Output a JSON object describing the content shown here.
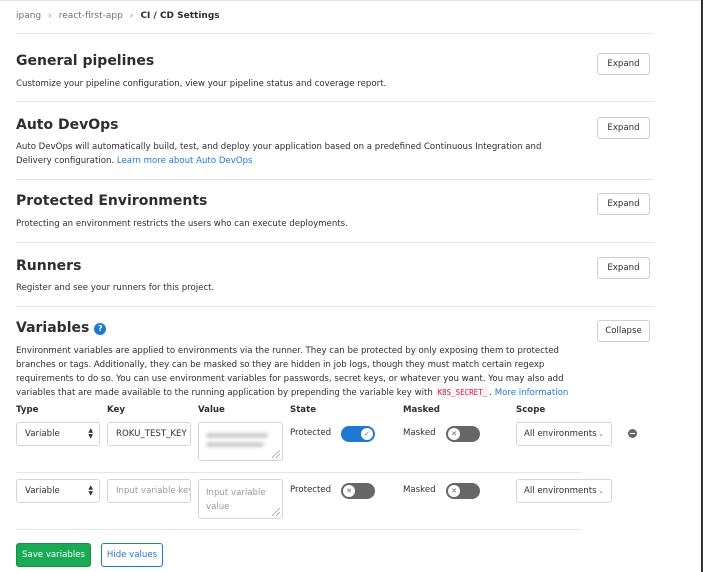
{
  "breadcrumb": {
    "items": [
      "ipang",
      "react-first-app",
      "CI / CD Settings"
    ]
  },
  "sections": {
    "general": {
      "title": "General pipelines",
      "description": "Customize your pipeline configuration, view your pipeline status and coverage report.",
      "button": "Expand"
    },
    "autodevops": {
      "title": "Auto DevOps",
      "description": "Auto DevOps will automatically build, test, and deploy your application based on a predefined Continuous Integration and Delivery configuration.",
      "link": "Learn more about Auto DevOps",
      "button": "Expand"
    },
    "protected": {
      "title": "Protected Environments",
      "description": "Protecting an environment restricts the users who can execute deployments.",
      "button": "Expand"
    },
    "runners": {
      "title": "Runners",
      "description": "Register and see your runners for this project.",
      "button": "Expand"
    },
    "variables": {
      "title": "Variables",
      "help_icon": "?",
      "button": "Collapse",
      "description": "Environment variables are applied to environments via the runner. They can be protected by only exposing them to protected branches or tags. Additionally, they can be masked so they are hidden in job logs, though they must match certain regexp requirements to do so. You can use environment variables for passwords, secret keys, or whatever you want. You may also add variables that are made available to the running application by prepending the variable key with",
      "code": "K8S_SECRET_",
      "link": "More information"
    }
  },
  "table": {
    "headers": {
      "type": "Type",
      "key": "Key",
      "value": "Value",
      "state": "State",
      "masked": "Masked",
      "scope": "Scope"
    },
    "rows": [
      {
        "type": "Variable",
        "key": "ROKU_TEST_KEY",
        "value_hidden": true,
        "state_label": "Protected",
        "protected": true,
        "masked_label": "Masked",
        "masked": false,
        "scope": "All environments"
      },
      {
        "type": "Variable",
        "key_placeholder": "Input variable key",
        "value_placeholder": "Input variable value",
        "state_label": "Protected",
        "protected": false,
        "masked_label": "Masked",
        "masked": false,
        "scope": "All environments"
      }
    ]
  },
  "actions": {
    "save": "Save variables",
    "hide": "Hide values"
  },
  "colors": {
    "primary": "#1f78d1",
    "success": "#1aaa55",
    "code": "#c7254e"
  }
}
